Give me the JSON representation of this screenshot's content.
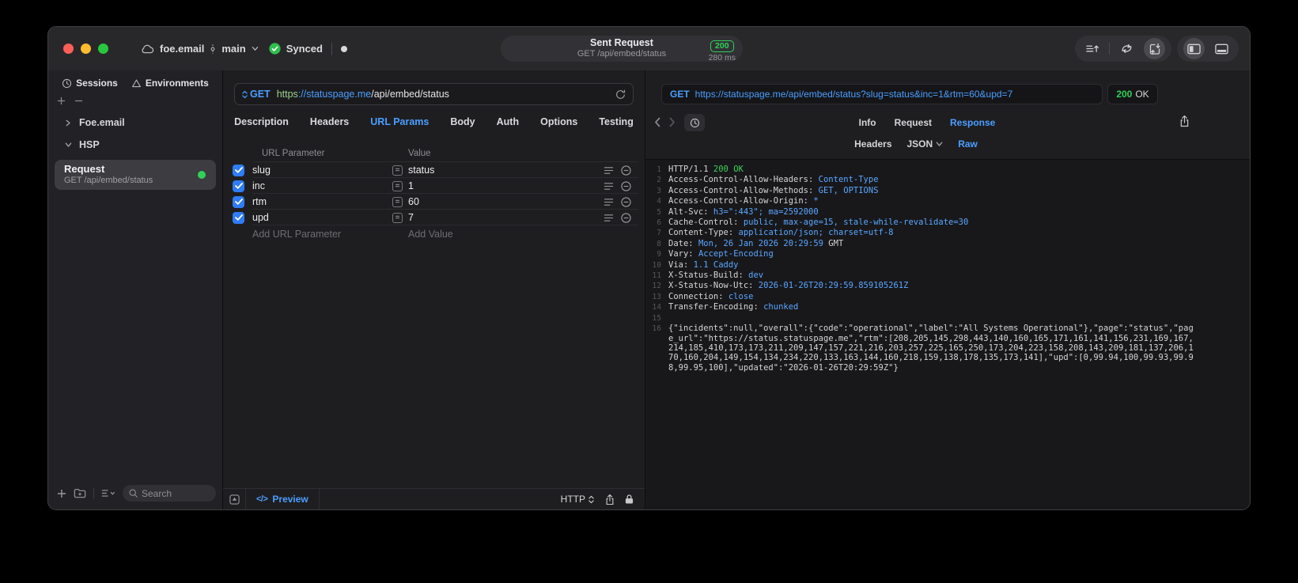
{
  "titlebar": {
    "project_name": "foe.email",
    "branch_name": "main",
    "sync_label": "Synced",
    "center": {
      "title": "Sent Request",
      "subtitle": "GET /api/embed/status",
      "status_code": "200",
      "duration": "280 ms"
    }
  },
  "sidebar": {
    "tabs": [
      {
        "label": "Sessions",
        "icon": "clock-icon"
      },
      {
        "label": "Environments",
        "icon": "environments-icon"
      }
    ],
    "tree": [
      {
        "label": "Foe.email",
        "expanded": false
      },
      {
        "label": "HSP",
        "expanded": true
      }
    ],
    "selected_request": {
      "title": "Request",
      "subtitle": "GET /api/embed/status"
    },
    "search_placeholder": "Search"
  },
  "request_editor": {
    "method": "GET",
    "url": {
      "scheme": "https",
      "host": "://statuspage.me",
      "path": "/api/embed/status"
    },
    "tabs": [
      "Description",
      "Headers",
      "URL Params",
      "Body",
      "Auth",
      "Options",
      "Testing"
    ],
    "active_tab": "URL Params",
    "params": {
      "columns": [
        "URL Parameter",
        "Value"
      ],
      "rows": [
        {
          "name": "slug",
          "value": "status",
          "checked": true
        },
        {
          "name": "inc",
          "value": "1",
          "checked": true
        },
        {
          "name": "rtm",
          "value": "60",
          "checked": true
        },
        {
          "name": "upd",
          "value": "7",
          "checked": true
        }
      ],
      "add_name_placeholder": "Add URL Parameter",
      "add_value_placeholder": "Add Value"
    },
    "footer": {
      "code_glyph": "</>",
      "preview_label": "Preview",
      "protocol_label": "HTTP"
    }
  },
  "response_viewer": {
    "method": "GET",
    "url": "https://statuspage.me/api/embed/status?slug=status&inc=1&rtm=60&upd=7",
    "status_code": "200",
    "status_text": "OK",
    "tabs": [
      "Info",
      "Request",
      "Response"
    ],
    "active_tab": "Response",
    "subtabs": [
      "Headers",
      "JSON",
      "Raw"
    ],
    "active_subtab": "Raw",
    "raw_lines": [
      {
        "n": "1",
        "parts": [
          [
            "HTTP/1.1 ",
            "plain"
          ],
          [
            "200 OK",
            "green"
          ]
        ]
      },
      {
        "n": "2",
        "parts": [
          [
            "Access-Control-Allow-Headers: ",
            "plain"
          ],
          [
            "Content-Type",
            "blue"
          ]
        ]
      },
      {
        "n": "3",
        "parts": [
          [
            "Access-Control-Allow-Methods: ",
            "plain"
          ],
          [
            "GET, OPTIONS",
            "blue"
          ]
        ]
      },
      {
        "n": "4",
        "parts": [
          [
            "Access-Control-Allow-Origin: ",
            "plain"
          ],
          [
            "*",
            "blue"
          ]
        ]
      },
      {
        "n": "5",
        "parts": [
          [
            "Alt-Svc: ",
            "plain"
          ],
          [
            "h3=\":443\"; ma=2592000",
            "blue"
          ]
        ]
      },
      {
        "n": "6",
        "parts": [
          [
            "Cache-Control: ",
            "plain"
          ],
          [
            "public, max-age=15, stale-while-revalidate=30",
            "blue"
          ]
        ]
      },
      {
        "n": "7",
        "parts": [
          [
            "Content-Type: ",
            "plain"
          ],
          [
            "application/json; charset=utf-8",
            "blue"
          ]
        ]
      },
      {
        "n": "8",
        "parts": [
          [
            "Date: ",
            "plain"
          ],
          [
            "Mon, 26 Jan 2026 20:29:59",
            "blue"
          ],
          [
            " GMT",
            "plain"
          ]
        ]
      },
      {
        "n": "9",
        "parts": [
          [
            "Vary: ",
            "plain"
          ],
          [
            "Accept-Encoding",
            "blue"
          ]
        ]
      },
      {
        "n": "10",
        "parts": [
          [
            "Via: ",
            "plain"
          ],
          [
            "1.1 Caddy",
            "blue"
          ]
        ]
      },
      {
        "n": "11",
        "parts": [
          [
            "X-Status-Build: ",
            "plain"
          ],
          [
            "dev",
            "blue"
          ]
        ]
      },
      {
        "n": "12",
        "parts": [
          [
            "X-Status-Now-Utc: ",
            "plain"
          ],
          [
            "2026-01-26T20:29:59.859105261Z",
            "blue"
          ]
        ]
      },
      {
        "n": "13",
        "parts": [
          [
            "Connection: ",
            "plain"
          ],
          [
            "close",
            "blue"
          ]
        ]
      },
      {
        "n": "14",
        "parts": [
          [
            "Transfer-Encoding: ",
            "plain"
          ],
          [
            "chunked",
            "blue"
          ]
        ]
      },
      {
        "n": "15",
        "parts": []
      },
      {
        "n": "16",
        "parts": [
          [
            "{\"incidents\":null,\"overall\":{\"code\":\"operational\",\"label\":\"All Systems Operational\"},\"page\":\"status\",\"page_url\":\"https://status.statuspage.me\",\"rtm\":[208,205,145,298,443,140,160,165,171,161,141,156,231,169,167,214,185,410,173,173,211,209,147,157,221,216,203,257,225,165,250,173,204,223,158,208,143,209,181,137,206,170,160,204,149,154,134,234,220,133,163,144,160,218,159,138,178,135,173,141],\"upd\":[0,99.94,100,99.93,99.98,99.95,100],\"updated\":\"2026-01-26T20:29:59Z\"}",
            "plain"
          ]
        ]
      }
    ]
  },
  "colors": {
    "accent": "#4b9fff",
    "success": "#30d158",
    "checkbox_blue": "#2f7cf6"
  }
}
